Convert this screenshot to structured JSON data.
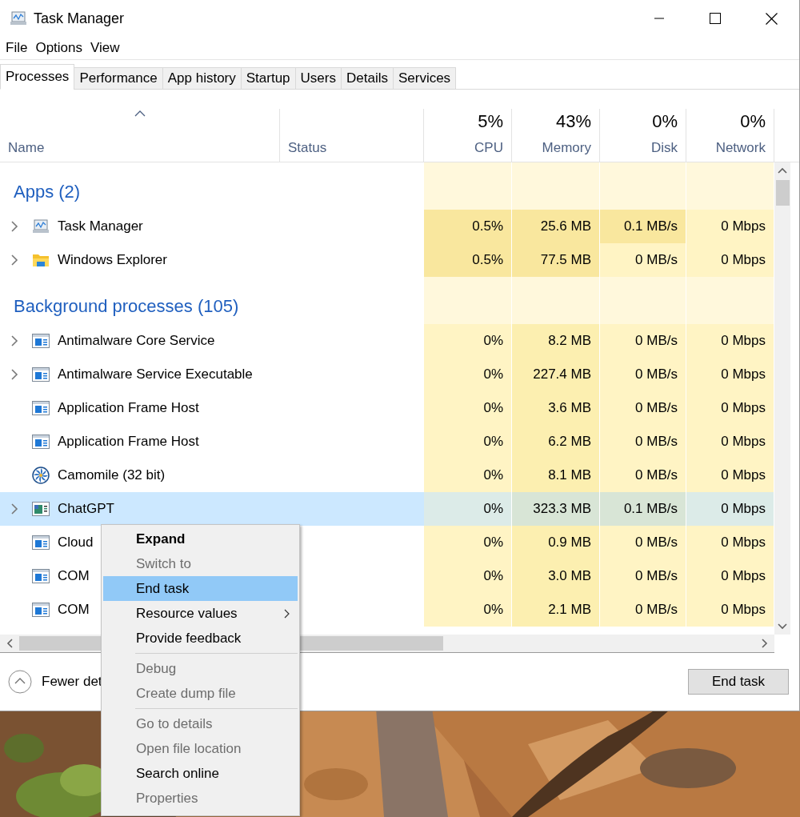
{
  "window": {
    "title": "Task Manager"
  },
  "menubar": [
    "File",
    "Options",
    "View"
  ],
  "tabs": [
    {
      "label": "Processes",
      "selected": true
    },
    {
      "label": "Performance",
      "selected": false
    },
    {
      "label": "App history",
      "selected": false
    },
    {
      "label": "Startup",
      "selected": false
    },
    {
      "label": "Users",
      "selected": false
    },
    {
      "label": "Details",
      "selected": false
    },
    {
      "label": "Services",
      "selected": false
    }
  ],
  "columns": [
    {
      "label": "Name",
      "sorted": true
    },
    {
      "label": "Status",
      "sorted": false
    },
    {
      "label": "CPU",
      "total": "5%",
      "sorted": false
    },
    {
      "label": "Memory",
      "total": "43%",
      "sorted": false
    },
    {
      "label": "Disk",
      "total": "0%",
      "sorted": false
    },
    {
      "label": "Network",
      "total": "0%",
      "sorted": false
    }
  ],
  "rows": [
    {
      "kind": "group",
      "label": "Apps (2)"
    },
    {
      "kind": "process",
      "name": "Task Manager",
      "expandable": true,
      "selected": false,
      "cells": [
        {
          "text": "0.5%",
          "color": "#f9e79e"
        },
        {
          "text": "25.6 MB",
          "color": "#f9e79e"
        },
        {
          "text": "0.1 MB/s",
          "color": "#f9e79e"
        },
        {
          "text": "0 Mbps",
          "color": "#fff4c4"
        }
      ]
    },
    {
      "kind": "process",
      "name": "Windows Explorer",
      "expandable": true,
      "selected": false,
      "cells": [
        {
          "text": "0.5%",
          "color": "#f9e79e"
        },
        {
          "text": "77.5 MB",
          "color": "#f9e79e"
        },
        {
          "text": "0 MB/s",
          "color": "#fff4c4"
        },
        {
          "text": "0 Mbps",
          "color": "#fff4c4"
        }
      ]
    },
    {
      "kind": "group",
      "label": "Background processes (105)"
    },
    {
      "kind": "process",
      "name": "Antimalware Core Service",
      "expandable": true,
      "selected": false,
      "cells": [
        {
          "text": "0%",
          "color": "#fff4c4"
        },
        {
          "text": "8.2 MB",
          "color": "#fcefb0"
        },
        {
          "text": "0 MB/s",
          "color": "#fff4c4"
        },
        {
          "text": "0 Mbps",
          "color": "#fff4c4"
        }
      ]
    },
    {
      "kind": "process",
      "name": "Antimalware Service Executable",
      "expandable": true,
      "selected": false,
      "cells": [
        {
          "text": "0%",
          "color": "#fff4c4"
        },
        {
          "text": "227.4 MB",
          "color": "#fcefb0"
        },
        {
          "text": "0 MB/s",
          "color": "#fff4c4"
        },
        {
          "text": "0 Mbps",
          "color": "#fff4c4"
        }
      ]
    },
    {
      "kind": "process",
      "name": "Application Frame Host",
      "expandable": false,
      "selected": false,
      "cells": [
        {
          "text": "0%",
          "color": "#fff4c4"
        },
        {
          "text": "3.6 MB",
          "color": "#fcefb0"
        },
        {
          "text": "0 MB/s",
          "color": "#fff4c4"
        },
        {
          "text": "0 Mbps",
          "color": "#fff4c4"
        }
      ]
    },
    {
      "kind": "process",
      "name": "Application Frame Host",
      "expandable": false,
      "selected": false,
      "cells": [
        {
          "text": "0%",
          "color": "#fff4c4"
        },
        {
          "text": "6.2 MB",
          "color": "#fcefb0"
        },
        {
          "text": "0 MB/s",
          "color": "#fff4c4"
        },
        {
          "text": "0 Mbps",
          "color": "#fff4c4"
        }
      ]
    },
    {
      "kind": "process",
      "name": "Camomile (32 bit)",
      "expandable": false,
      "selected": false,
      "cells": [
        {
          "text": "0%",
          "color": "#fff4c4"
        },
        {
          "text": "8.1 MB",
          "color": "#fcefb0"
        },
        {
          "text": "0 MB/s",
          "color": "#fff4c4"
        },
        {
          "text": "0 Mbps",
          "color": "#fff4c4"
        }
      ]
    },
    {
      "kind": "process",
      "name": "ChatGPT",
      "expandable": true,
      "selected": true,
      "cells": [
        {
          "text": "0%",
          "color": "#dcebe8"
        },
        {
          "text": "323.3 MB",
          "color": "#d8e5d6"
        },
        {
          "text": "0.1 MB/s",
          "color": "#d8e5d6"
        },
        {
          "text": "0 Mbps",
          "color": "#dcebe8"
        }
      ]
    },
    {
      "kind": "process",
      "name": "Cloud",
      "expandable": false,
      "selected": false,
      "cells": [
        {
          "text": "0%",
          "color": "#fff4c4"
        },
        {
          "text": "0.9 MB",
          "color": "#fcefb0"
        },
        {
          "text": "0 MB/s",
          "color": "#fff4c4"
        },
        {
          "text": "0 Mbps",
          "color": "#fff4c4"
        }
      ]
    },
    {
      "kind": "process",
      "name": "COM",
      "expandable": false,
      "selected": false,
      "cells": [
        {
          "text": "0%",
          "color": "#fff4c4"
        },
        {
          "text": "3.0 MB",
          "color": "#fcefb0"
        },
        {
          "text": "0 MB/s",
          "color": "#fff4c4"
        },
        {
          "text": "0 Mbps",
          "color": "#fff4c4"
        }
      ]
    },
    {
      "kind": "process",
      "name": "COM",
      "expandable": false,
      "selected": false,
      "cells": [
        {
          "text": "0%",
          "color": "#fff4c4"
        },
        {
          "text": "2.1 MB",
          "color": "#fcefb0"
        },
        {
          "text": "0 MB/s",
          "color": "#fff4c4"
        },
        {
          "text": "0 Mbps",
          "color": "#fff4c4"
        }
      ]
    }
  ],
  "footer": {
    "details_link": "Fewer det",
    "end_task": "End task"
  },
  "context_menu": [
    {
      "kind": "item",
      "label": "Expand",
      "bold": true,
      "disabled": false,
      "selected": false,
      "submenu": false
    },
    {
      "kind": "item",
      "label": "Switch to",
      "bold": false,
      "disabled": true,
      "selected": false,
      "submenu": false
    },
    {
      "kind": "item",
      "label": "End task",
      "bold": false,
      "disabled": false,
      "selected": true,
      "submenu": false
    },
    {
      "kind": "item",
      "label": "Resource values",
      "bold": false,
      "disabled": false,
      "selected": false,
      "submenu": true
    },
    {
      "kind": "item",
      "label": "Provide feedback",
      "bold": false,
      "disabled": false,
      "selected": false,
      "submenu": false
    },
    {
      "kind": "separator"
    },
    {
      "kind": "item",
      "label": "Debug",
      "bold": false,
      "disabled": true,
      "selected": false,
      "submenu": false
    },
    {
      "kind": "item",
      "label": "Create dump file",
      "bold": false,
      "disabled": true,
      "selected": false,
      "submenu": false
    },
    {
      "kind": "separator"
    },
    {
      "kind": "item",
      "label": "Go to details",
      "bold": false,
      "disabled": true,
      "selected": false,
      "submenu": false
    },
    {
      "kind": "item",
      "label": "Open file location",
      "bold": false,
      "disabled": true,
      "selected": false,
      "submenu": false
    },
    {
      "kind": "item",
      "label": "Search online",
      "bold": false,
      "disabled": false,
      "selected": false,
      "submenu": false
    },
    {
      "kind": "item",
      "label": "Properties",
      "bold": false,
      "disabled": true,
      "selected": false,
      "submenu": false
    }
  ]
}
